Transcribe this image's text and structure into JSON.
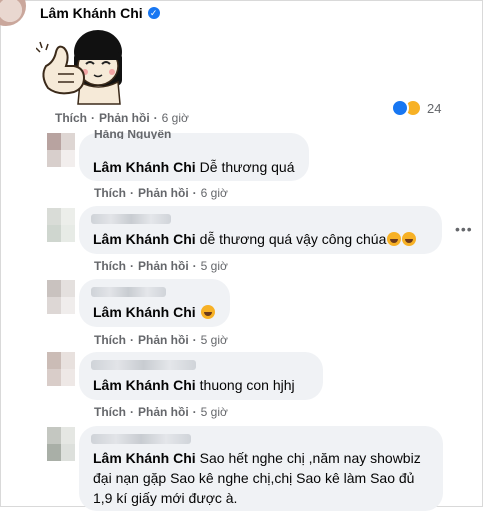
{
  "post": {
    "author": "Lâm Khánh Chi",
    "action_like": "Thích",
    "action_reply": "Phản hồi",
    "time": "6 giờ",
    "reaction_count": "24"
  },
  "comments": [
    {
      "author": "Hằng Nguyễn",
      "mention": "Lâm Khánh Chi",
      "text": "Dễ thương quá",
      "like": "Thích",
      "reply": "Phản hồi",
      "time": "6 giờ"
    },
    {
      "mention": "Lâm Khánh Chi",
      "text": "dễ thương quá vậy công chúa",
      "like": "Thích",
      "reply": "Phản hồi",
      "time": "5 giờ"
    },
    {
      "mention": "Lâm Khánh Chi",
      "text": "",
      "like": "Thích",
      "reply": "Phản hồi",
      "time": "5 giờ"
    },
    {
      "mention": "Lâm Khánh Chi",
      "text": "thuong con hjhj",
      "like": "Thích",
      "reply": "Phản hồi",
      "time": "5 giờ"
    },
    {
      "mention": "Lâm Khánh Chi",
      "text_line1": "Sao hết nghe chị ,năm nay showbiz",
      "text_line2": "đại nạn gặp Sao kê nghe chị,chị Sao kê làm Sao đủ",
      "text_line3": "1,9 kí giấy mới được à."
    }
  ],
  "icons": {
    "verified": "verified-badge-icon",
    "like": "like-reaction-icon",
    "haha": "haha-reaction-icon",
    "more": "more-options-icon"
  },
  "colors": {
    "accent": "#1877f2",
    "bubble": "#f0f2f5",
    "secondary_text": "#65676b"
  }
}
